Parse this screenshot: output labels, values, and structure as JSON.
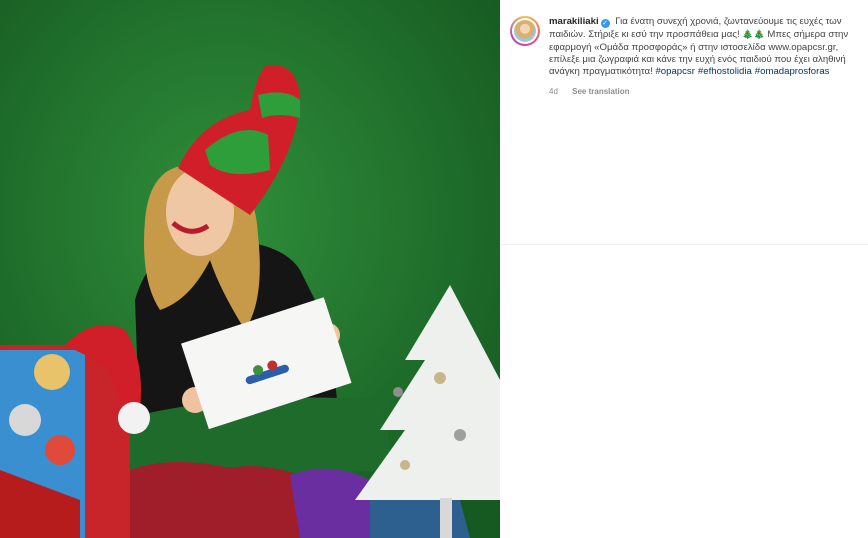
{
  "post": {
    "username": "marakiliaki",
    "caption_line1": "Για ένατη συνεχή χρονιά, ζωντανεύουμε τις ευχές των παιδιών. Στήριξε κι εσύ την προσπάθεια μας!",
    "emoji": "🎄🎄",
    "caption_line2": "Μπες σήμερα στην εφαρμογή «Ομάδα προσφοράς» ή στην ιστοσελίδα www.opapcsr.gr, επίλεξε μια ζωγραφιά και κάνε την ευχή ενός παιδιού που έχει αληθινή ανάγκη πραγματικότητα!",
    "hashtags": [
      "#opapcsr",
      "#efhostolidia",
      "#omadaprosforas"
    ],
    "age": "4d",
    "see_translation": "See translation"
  },
  "colors": {
    "background_green": "#1f7a2e",
    "link": "#00376b",
    "verified": "#3897f0"
  }
}
